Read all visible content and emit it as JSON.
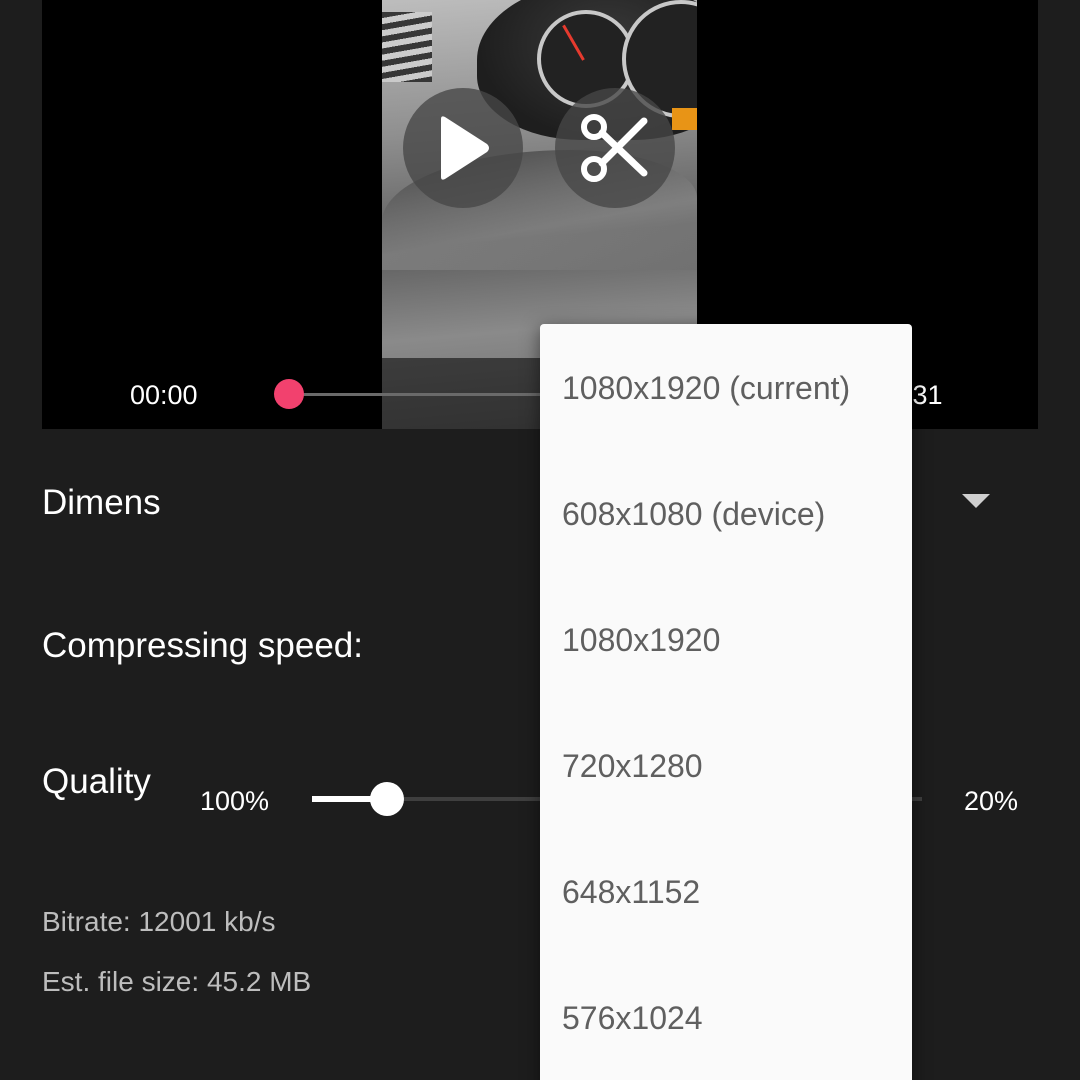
{
  "player": {
    "time_current": "00:00",
    "time_total": ":31",
    "play_icon": "play-icon",
    "trim_icon": "scissors-icon",
    "accent_color": "#f2416e"
  },
  "settings": {
    "dimensions_label": "Dimens",
    "speed_label": "Compressing speed:",
    "quality_label": "Quality",
    "quality_min": "100%",
    "quality_max": "20%",
    "quality_value_fraction": 0.12,
    "bitrate": "Bitrate: 12001 kb/s",
    "file_size": "Est. file size: 45.2 MB"
  },
  "dimension_options": [
    "1080x1920 (current)",
    "608x1080 (device)",
    "1080x1920",
    "720x1280",
    "648x1152",
    "576x1024"
  ]
}
